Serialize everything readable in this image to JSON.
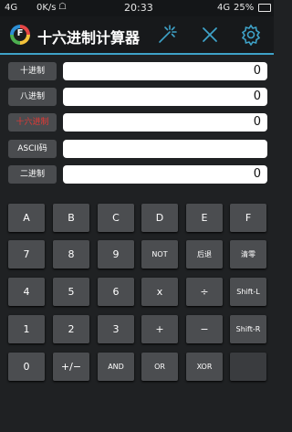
{
  "status_bar": {
    "signal": "4G",
    "speed": "0K/s",
    "time": "20:33",
    "network": "4G",
    "battery": "25%"
  },
  "app": {
    "title": "十六进制计算器",
    "logo_letter": "F"
  },
  "rows": [
    {
      "label": "十进制",
      "value": "0",
      "label_color": "#ffffff"
    },
    {
      "label": "八进制",
      "value": "0",
      "label_color": "#ffffff"
    },
    {
      "label": "十六进制",
      "value": "0",
      "label_color": "#e53935"
    },
    {
      "label": "ASCII码",
      "value": "",
      "label_color": "#ffffff"
    },
    {
      "label": "二进制",
      "value": "0",
      "label_color": "#ffffff"
    }
  ],
  "keypad": [
    [
      "A",
      "B",
      "C",
      "D",
      "E",
      "F"
    ],
    [
      "7",
      "8",
      "9",
      "NOT",
      "后退",
      "清零"
    ],
    [
      "4",
      "5",
      "6",
      "x",
      "÷",
      "Shift-L"
    ],
    [
      "1",
      "2",
      "3",
      "+",
      "−",
      "Shift-R"
    ],
    [
      "0",
      "+/−",
      "AND",
      "OR",
      "XOR",
      ""
    ]
  ],
  "colors": {
    "accent": "#3ea2c8",
    "background": "#1f2123",
    "key": "#4b4d50",
    "label_button": "#4a4c4f"
  }
}
